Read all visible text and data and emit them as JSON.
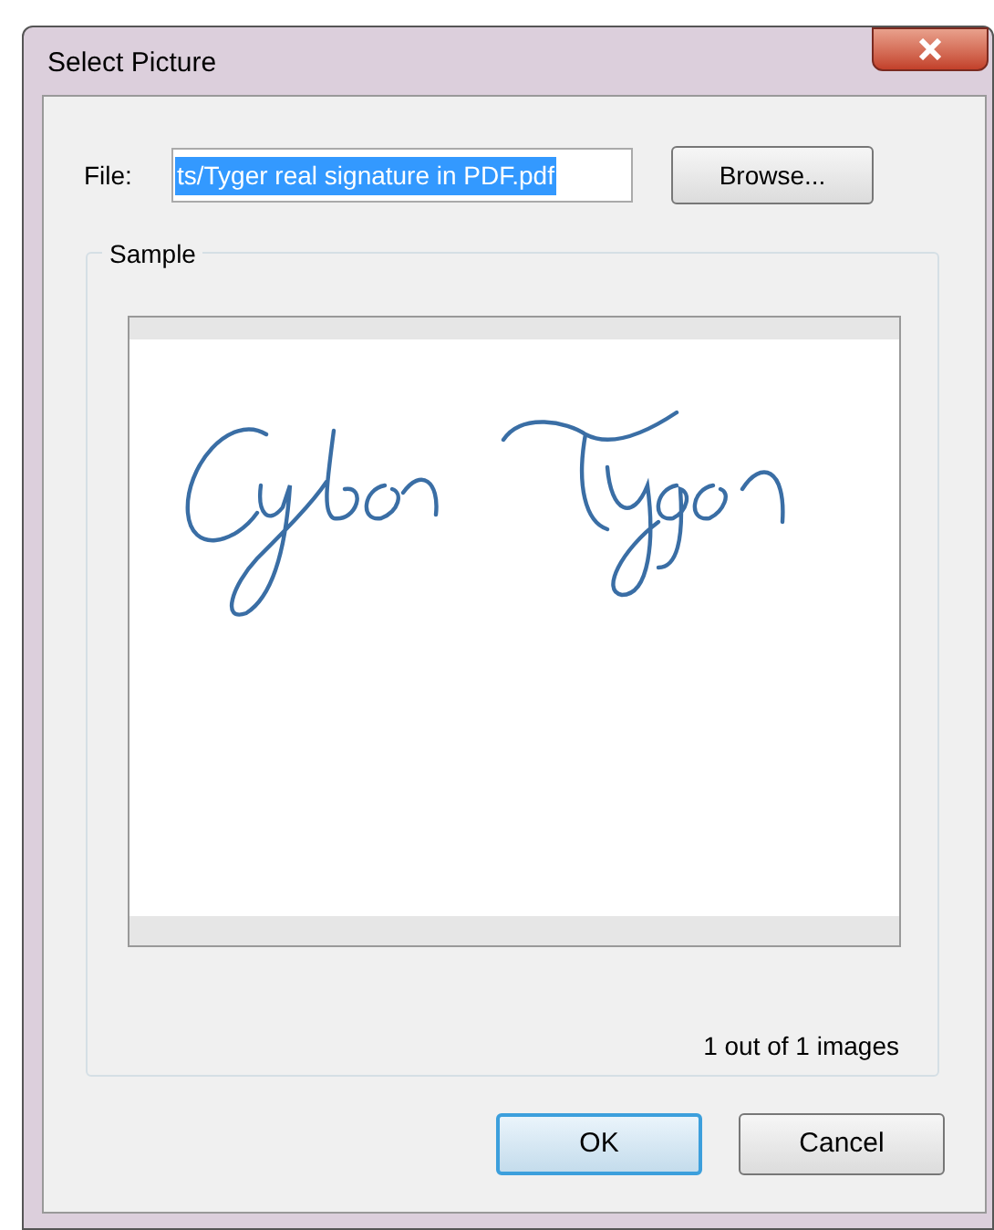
{
  "window": {
    "title": "Select Picture"
  },
  "file": {
    "label": "File:",
    "value": "ts/Tyger real signature in PDF.pdf",
    "selected": true
  },
  "browse_button": "Browse...",
  "sample": {
    "title": "Sample",
    "counter": "1 out of 1 images"
  },
  "buttons": [
    {
      "label": "OK",
      "default": true
    },
    {
      "label": "Cancel",
      "default": false
    }
  ]
}
